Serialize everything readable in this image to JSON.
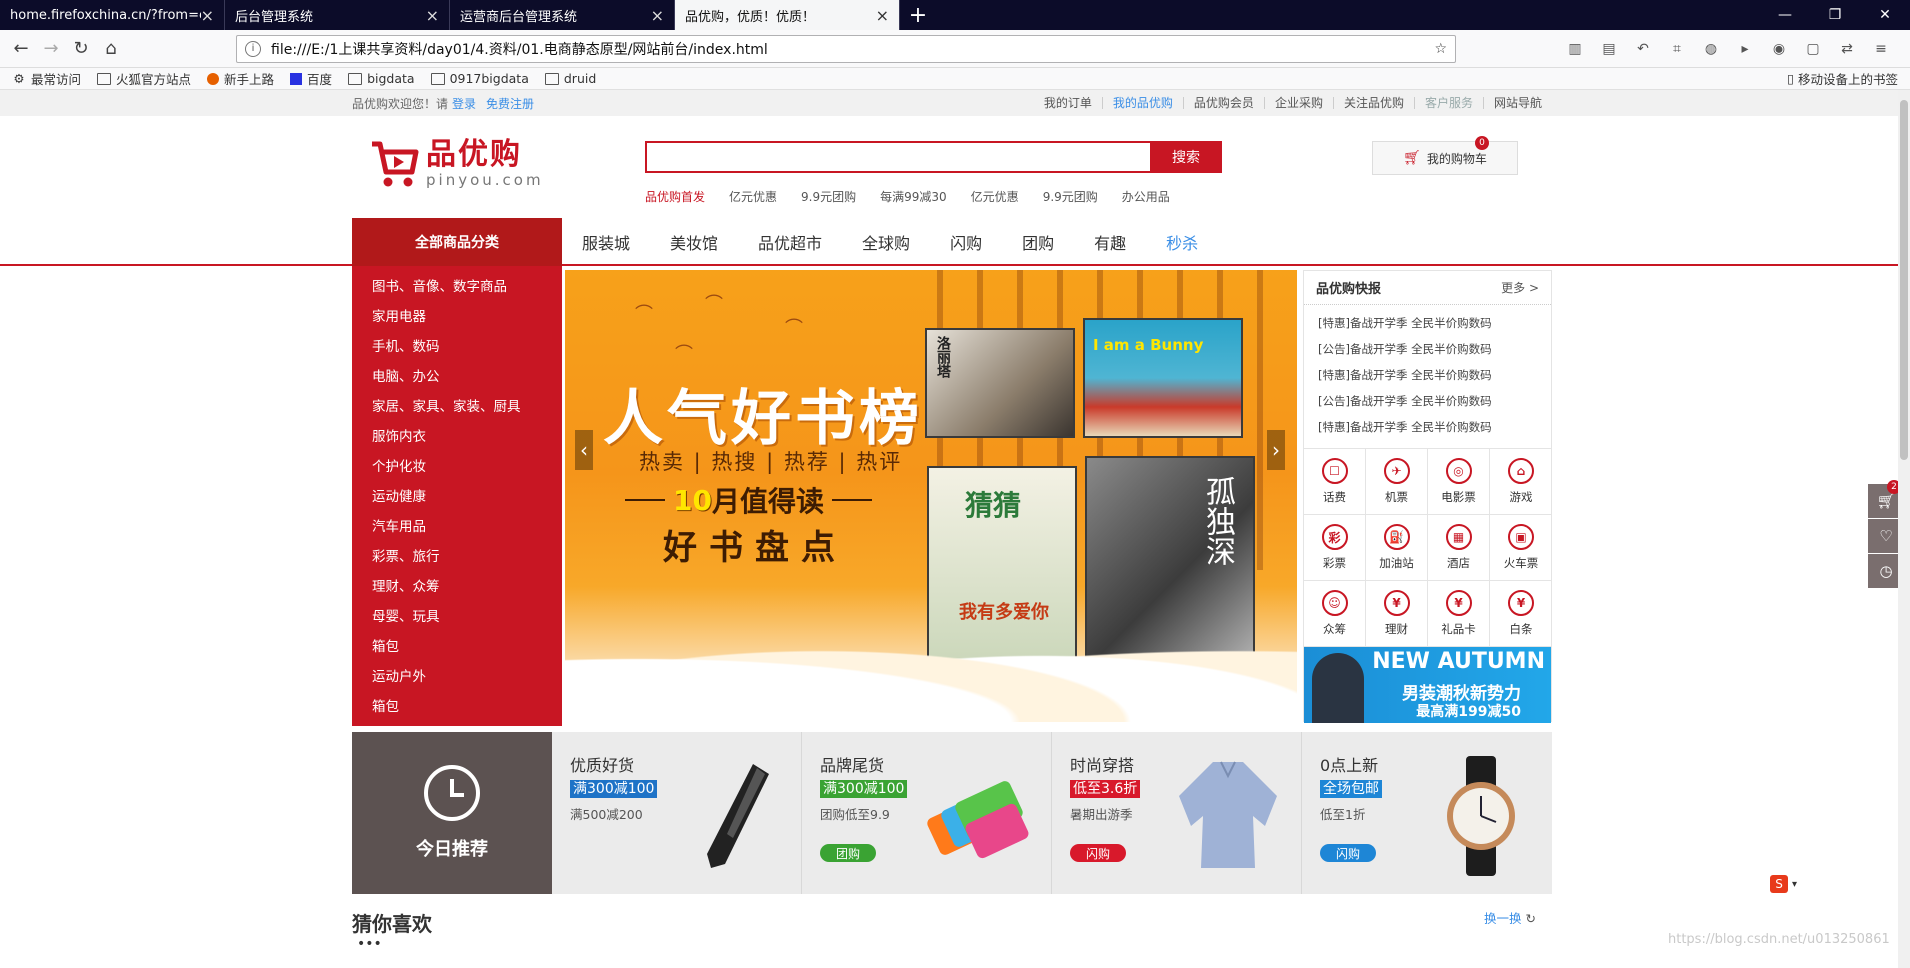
{
  "browser": {
    "tabs": [
      {
        "title": "home.firefoxchina.cn/?from=ext",
        "active": false
      },
      {
        "title": "后台管理系统",
        "active": false
      },
      {
        "title": "运营商后台管理系统",
        "active": false
      },
      {
        "title": "品优购，优质！优质！",
        "active": true
      }
    ],
    "url": "file:///E:/1上课共享资料/day01/4.资料/01.电商静态原型/网站前台/index.html",
    "bookmarks": [
      "最常访问",
      "火狐官方站点",
      "新手上路",
      "百度",
      "bigdata",
      "0917bigdata",
      "druid"
    ],
    "mobile_bookmarks": "移动设备上的书签"
  },
  "shortcut": {
    "welcome": "品优购欢迎您！请",
    "login": "登录",
    "register": "免费注册",
    "links": [
      "我的订单",
      "我的品优购",
      "品优购会员",
      "企业采购",
      "关注品优购",
      "客户服务",
      "网站导航"
    ]
  },
  "header": {
    "logo_cn": "品优购",
    "logo_en": "pinyou.com",
    "search_button": "搜索",
    "search_value": "",
    "hotwords": [
      "品优购首发",
      "亿元优惠",
      "9.9元团购",
      "每满99减30",
      "亿元优惠",
      "9.9元团购",
      "办公用品"
    ],
    "cart_label": "我的购物车",
    "cart_count": "0"
  },
  "nav": {
    "all_label": "全部商品分类",
    "items": [
      "服装城",
      "美妆馆",
      "品优超市",
      "全球购",
      "闪购",
      "团购",
      "有趣",
      "秒杀"
    ]
  },
  "categories": [
    "图书、音像、数字商品",
    "家用电器",
    "手机、数码",
    "电脑、办公",
    "家居、家具、家装、厨具",
    "服饰内衣",
    "个护化妆",
    "运动健康",
    "汽车用品",
    "彩票、旅行",
    "理财、众筹",
    "母婴、玩具",
    "箱包",
    "运动户外",
    "箱包"
  ],
  "banner": {
    "title": "人气好书榜",
    "subtitle": "热卖 | 热搜 | 热荐 | 热评",
    "month_num": "10",
    "month_text": "月值得读",
    "check": "好书盘点",
    "book1": "洛丽塔",
    "book2": "I am a Bunny",
    "book3": "猜猜",
    "book3_sub": "我有多爱你",
    "book4": "孤独深"
  },
  "news": {
    "title": "品优购快报",
    "more": "更多 >",
    "items": [
      {
        "tag": "[特惠]",
        "text": "备战开学季 全民半价购数码"
      },
      {
        "tag": "[公告]",
        "text": "备战开学季 全民半价购数码"
      },
      {
        "tag": "[特惠]",
        "text": "备战开学季 全民半价购数码"
      },
      {
        "tag": "[公告]",
        "text": "备战开学季 全民半价购数码"
      },
      {
        "tag": "[特惠]",
        "text": "备战开学季 全民半价购数码"
      }
    ],
    "services": [
      {
        "label": "话费",
        "glyph": "☐"
      },
      {
        "label": "机票",
        "glyph": "✈"
      },
      {
        "label": "电影票",
        "glyph": "◎"
      },
      {
        "label": "游戏",
        "glyph": "⌂"
      },
      {
        "label": "彩票",
        "glyph": "彩"
      },
      {
        "label": "加油站",
        "glyph": "⛽"
      },
      {
        "label": "酒店",
        "glyph": "▦"
      },
      {
        "label": "火车票",
        "glyph": "▣"
      },
      {
        "label": "众筹",
        "glyph": "☺"
      },
      {
        "label": "理财",
        "glyph": "¥"
      },
      {
        "label": "礼品卡",
        "glyph": "¥"
      },
      {
        "label": "白条",
        "glyph": "¥"
      }
    ],
    "ad_en": "NEW AUTUMN",
    "ad_cn": "男装潮秋新势力",
    "ad_promo": "最高满199减50"
  },
  "recommend": {
    "title": "今日推荐",
    "items": [
      {
        "title": "优质好货",
        "tag": "满300减100",
        "tag_color": "#1e73c7",
        "desc": "满500减200",
        "pill": ""
      },
      {
        "title": "品牌尾货",
        "tag": "满300减100",
        "tag_color": "#3aa333",
        "desc": "团购低至9.9",
        "pill": "团购",
        "pill_color": "#3aa333"
      },
      {
        "title": "时尚穿搭",
        "tag": "低至3.6折",
        "tag_color": "#d8192b",
        "desc": "暑期出游季",
        "pill": "闪购",
        "pill_color": "#d8192b"
      },
      {
        "title": "0点上新",
        "tag": "全场包邮",
        "tag_color": "#1e86d6",
        "desc": "低至1折",
        "pill": "闪购",
        "pill_color": "#1e86d6"
      }
    ]
  },
  "guess": {
    "title": "猜你喜欢",
    "refresh": "换一换"
  },
  "side": {
    "cart_badge": "2"
  },
  "watermark": "https://blog.csdn.net/u013250861",
  "colors": {
    "brand": "#c81623",
    "link": "#3a8ee6"
  }
}
